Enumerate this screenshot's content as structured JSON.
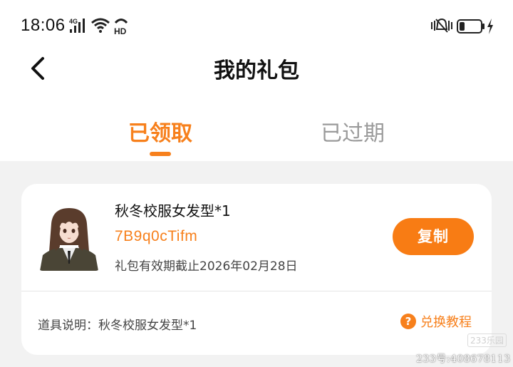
{
  "status_bar": {
    "time": "18:06",
    "network_label": "4G",
    "hd_label": "HD",
    "icons": [
      "signal-icon",
      "wifi-icon",
      "hd-call-icon",
      "vibrate-mute-icon",
      "battery-icon",
      "charging-icon"
    ],
    "battery_level": 0.25
  },
  "header": {
    "title": "我的礼包",
    "back_icon": "back-arrow-icon"
  },
  "tabs": [
    {
      "label": "已领取",
      "active": true
    },
    {
      "label": "已过期",
      "active": false
    }
  ],
  "gift_card": {
    "name": "秋冬校服女发型*1",
    "code": "7B9q0cTifm",
    "expiry": "礼包有效期截止2026年02月28日",
    "copy_label": "复制",
    "description": "道具说明：秋冬校服女发型*1",
    "tutorial_label": "兑换教程",
    "tutorial_icon_glyph": "?"
  },
  "watermark": {
    "logo_text": "233乐园",
    "id_text": "233号:408678113"
  },
  "colors": {
    "accent": "#f7801c",
    "background": "#f2f2f2",
    "card": "#ffffff",
    "inactive_tab": "#9a9a9a"
  }
}
